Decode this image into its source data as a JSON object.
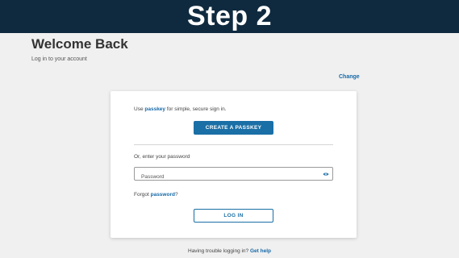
{
  "banner": {
    "text": "Step 2"
  },
  "header": {
    "title": "Welcome Back",
    "subtitle": "Log in to your account",
    "change_link": "Change"
  },
  "card": {
    "passkey_prefix": "Use",
    "passkey_word": "passkey",
    "passkey_suffix": "for simple, secure sign in.",
    "create_passkey_button": "CREATE A PASSKEY",
    "or_text": "Or, enter your password",
    "password_placeholder": "Password",
    "password_value": "",
    "forgot_prefix": "Forgot",
    "forgot_word": "password",
    "forgot_suffix": "?",
    "login_button": "LOG IN"
  },
  "footer": {
    "trouble_text": "Having trouble logging in?",
    "help_link": "Get help"
  },
  "icons": {
    "password_toggle": "eye-icon"
  },
  "colors": {
    "banner_bg": "#0f2a3f",
    "accent": "#1a6fa6",
    "link": "#1569a8",
    "page_bg": "#f0f0f0"
  }
}
